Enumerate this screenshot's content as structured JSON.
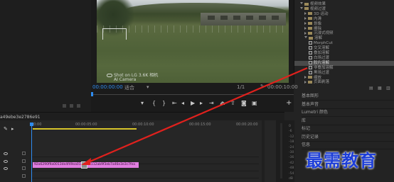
{
  "monitor": {
    "timecode": "00:00:00:00",
    "fit_label": "适合",
    "ratio": "1/1",
    "end_timecode": "00:00:10:00",
    "watermark_line1": "Shot on LG 3.6K 相机",
    "watermark_line2": "AI Camera"
  },
  "effects": {
    "items": [
      {
        "label": "视频效果",
        "indent": 1,
        "type": "folder",
        "open": true
      },
      {
        "label": "视频过渡",
        "indent": 1,
        "type": "folder",
        "open": true
      },
      {
        "label": "3D 运动",
        "indent": 2,
        "type": "folder",
        "open": false
      },
      {
        "label": "内滑",
        "indent": 2,
        "type": "folder",
        "open": false
      },
      {
        "label": "划像",
        "indent": 2,
        "type": "folder",
        "open": false
      },
      {
        "label": "擦除",
        "indent": 2,
        "type": "folder",
        "open": false
      },
      {
        "label": "沉浸式视频",
        "indent": 2,
        "type": "folder",
        "open": false
      },
      {
        "label": "溶解",
        "indent": 2,
        "type": "folder",
        "open": true
      },
      {
        "label": "MorphCut",
        "indent": 3,
        "type": "fx",
        "open": false
      },
      {
        "label": "交叉溶解",
        "indent": 3,
        "type": "fx",
        "open": false
      },
      {
        "label": "叠加溶解",
        "indent": 3,
        "type": "fx",
        "open": false
      },
      {
        "label": "白场过渡",
        "indent": 3,
        "type": "fx",
        "open": false
      },
      {
        "label": "胶片溶解",
        "indent": 3,
        "type": "fx",
        "open": false,
        "selected": true
      },
      {
        "label": "非叠加溶解",
        "indent": 3,
        "type": "fx",
        "open": false
      },
      {
        "label": "黑场过渡",
        "indent": 3,
        "type": "fx",
        "open": false
      },
      {
        "label": "缩放",
        "indent": 2,
        "type": "folder",
        "open": false
      },
      {
        "label": "页面剥落",
        "indent": 2,
        "type": "folder",
        "open": false
      }
    ]
  },
  "panels": [
    "基本图形",
    "基本声音",
    "Lumetri 颜色",
    "库",
    "标记",
    "历史记录",
    "信息"
  ],
  "timeline": {
    "sequence_name": "a49ebe3e2786e91",
    "timecode": "00:00:00:00",
    "ruler": [
      "00:00",
      "00:00:05:00",
      "00:00:10:00",
      "00:00:15:00",
      "00:00:20:00"
    ],
    "clip1": "92a6290f9a0013de4f49ea01ae",
    "clip2": "4112ab9f3eb7a46e3e3c7fea",
    "meter_labels": [
      "0",
      "-6",
      "-12",
      "-18",
      "-24",
      "-30",
      "-36",
      "-42",
      "-48",
      "-54",
      "dB"
    ]
  },
  "brand": {
    "text": "最需教育",
    "color": "#1e3fd8"
  },
  "accent": "#2e8cf0",
  "arrow_color": "#e0211d"
}
